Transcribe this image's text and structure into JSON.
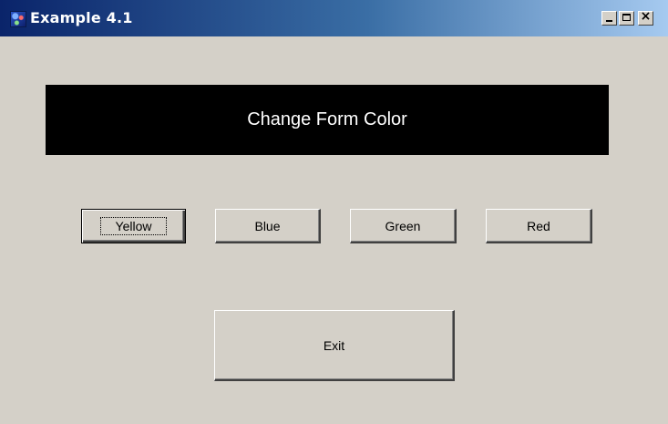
{
  "window": {
    "title": "Example 4.1",
    "icon": "app-icon",
    "caption_buttons": [
      "minimize",
      "maximize",
      "close"
    ],
    "close_glyph": "×"
  },
  "banner": {
    "text": "Change Form Color",
    "background": "#000000",
    "color": "#ffffff"
  },
  "buttons": {
    "yellow": "Yellow",
    "blue": "Blue",
    "green": "Green",
    "red": "Red",
    "exit": "Exit",
    "focused": "yellow"
  },
  "colors": {
    "form_background": "#d4d0c8",
    "titlebar_start": "#0a246a",
    "titlebar_end": "#a6caf0"
  }
}
